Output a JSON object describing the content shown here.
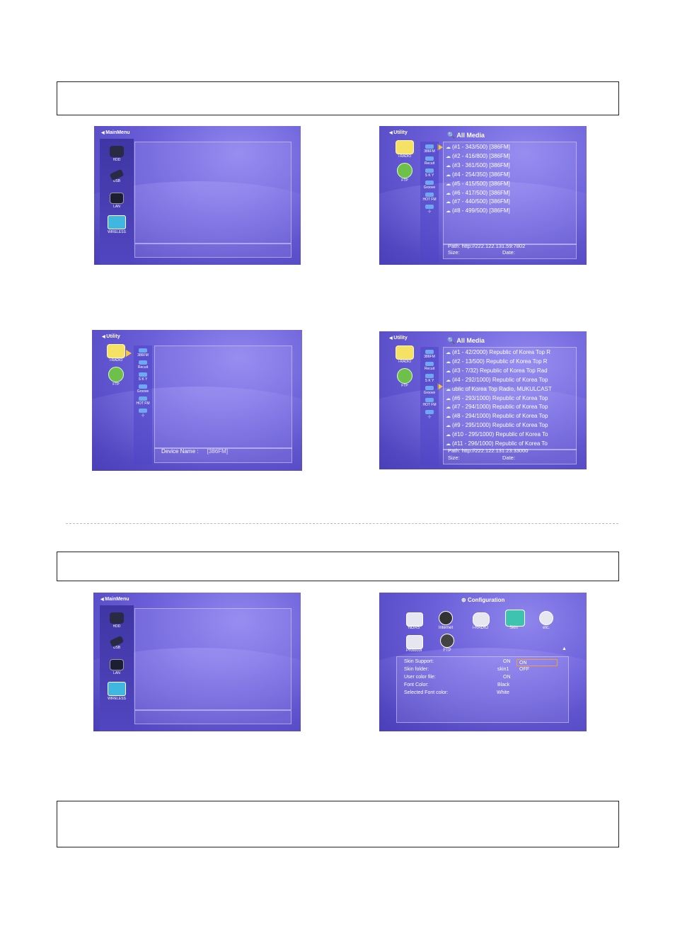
{
  "boxes": [],
  "shot_mm1": {
    "top_label": "MainMenu",
    "devices": [
      {
        "label": "HDD"
      },
      {
        "label": "USB"
      },
      {
        "label": "LAN"
      },
      {
        "label": "WIRELESS"
      }
    ]
  },
  "shot_util1": {
    "top_label": "Utility",
    "header": "All Media",
    "side": [
      {
        "label": "i-RADIO"
      },
      {
        "label": "FTP"
      }
    ],
    "channels": [
      "386FM",
      "Recuit",
      "S K Y",
      "Groove",
      "HOT FM",
      "-|-"
    ],
    "rows": [
      "(#1 - 343/500) [386FM]",
      "(#2 - 416/800) [386FM]",
      "(#3 - 361/500) [386FM]",
      "(#4 - 254/350) [386FM]",
      "(#5 - 415/500) [386FM]",
      "(#6 - 417/500) [386FM]",
      "(#7 - 440/500) [386FM]",
      "(#8 - 499/500) [386FM]"
    ],
    "path_label": "Path:",
    "path_value": "http://222.122.131.59:7802",
    "size_label": "Size:",
    "date_label": "Date:"
  },
  "shot_util2": {
    "top_label": "Utility",
    "side": [
      {
        "label": "i-RADIO"
      },
      {
        "label": "FTP"
      }
    ],
    "channels": [
      "386FM",
      "Recuit",
      "S K Y",
      "Groove",
      "HOT FM",
      "-|-"
    ],
    "device_name_label": "Device Name :",
    "device_name_value": "[386FM]"
  },
  "shot_util3": {
    "top_label": "Utility",
    "header": "All Media",
    "side": [
      {
        "label": "i-RADIO"
      },
      {
        "label": "FTP"
      }
    ],
    "channels": [
      "386FM",
      "Recuit",
      "S K Y",
      "Groove",
      "HOT FM",
      "-|-"
    ],
    "rows": [
      "(#1 - 42/2000) Republic of Korea Top R",
      "(#2 - 13/500) Republic of Korea Top R",
      "(#3 - 7/32) Republic of Korea Top Rad",
      "(#4 - 292/1000) Republic of Korea Top",
      "ublic of Korea Top Radio, MUKULCAST",
      "(#6 - 293/1000) Republic of Korea Top",
      "(#7 - 294/1000) Republic of Korea Top",
      "(#8 - 294/1000) Republic of Korea Top",
      "(#9 - 295/1000) Republic of Korea Top",
      "(#10 - 295/1000) Republic of Korea To",
      "(#11 - 296/1000) Republic of Korea To"
    ],
    "selected_row": 4,
    "path_label": "Path:",
    "path_value": "http://222.122.131.23:33000",
    "size_label": "Size:",
    "date_label": "Date:"
  },
  "shot_mm2": {
    "top_label": "MainMenu",
    "devices": [
      {
        "label": "HDD"
      },
      {
        "label": "USB"
      },
      {
        "label": "LAN"
      },
      {
        "label": "WIRELESS"
      }
    ]
  },
  "shot_cfg": {
    "title": "Configuration",
    "icons": [
      {
        "label": "NDAS"
      },
      {
        "label": "Internet"
      },
      {
        "label": "i-RADIO"
      },
      {
        "label": "Skin"
      },
      {
        "label": "etc."
      },
      {
        "label": "Protocol"
      },
      {
        "label": "FTP"
      }
    ],
    "settings": [
      {
        "name": "Skin Support:",
        "value": "ON"
      },
      {
        "name": "Skin folder:",
        "value": "skin1"
      },
      {
        "name": "User color file:",
        "value": "ON"
      },
      {
        "name": "Font Color:",
        "value": "Black"
      },
      {
        "name": "Selected Font color:",
        "value": "White"
      }
    ],
    "options": [
      "ON",
      "OFF"
    ]
  }
}
